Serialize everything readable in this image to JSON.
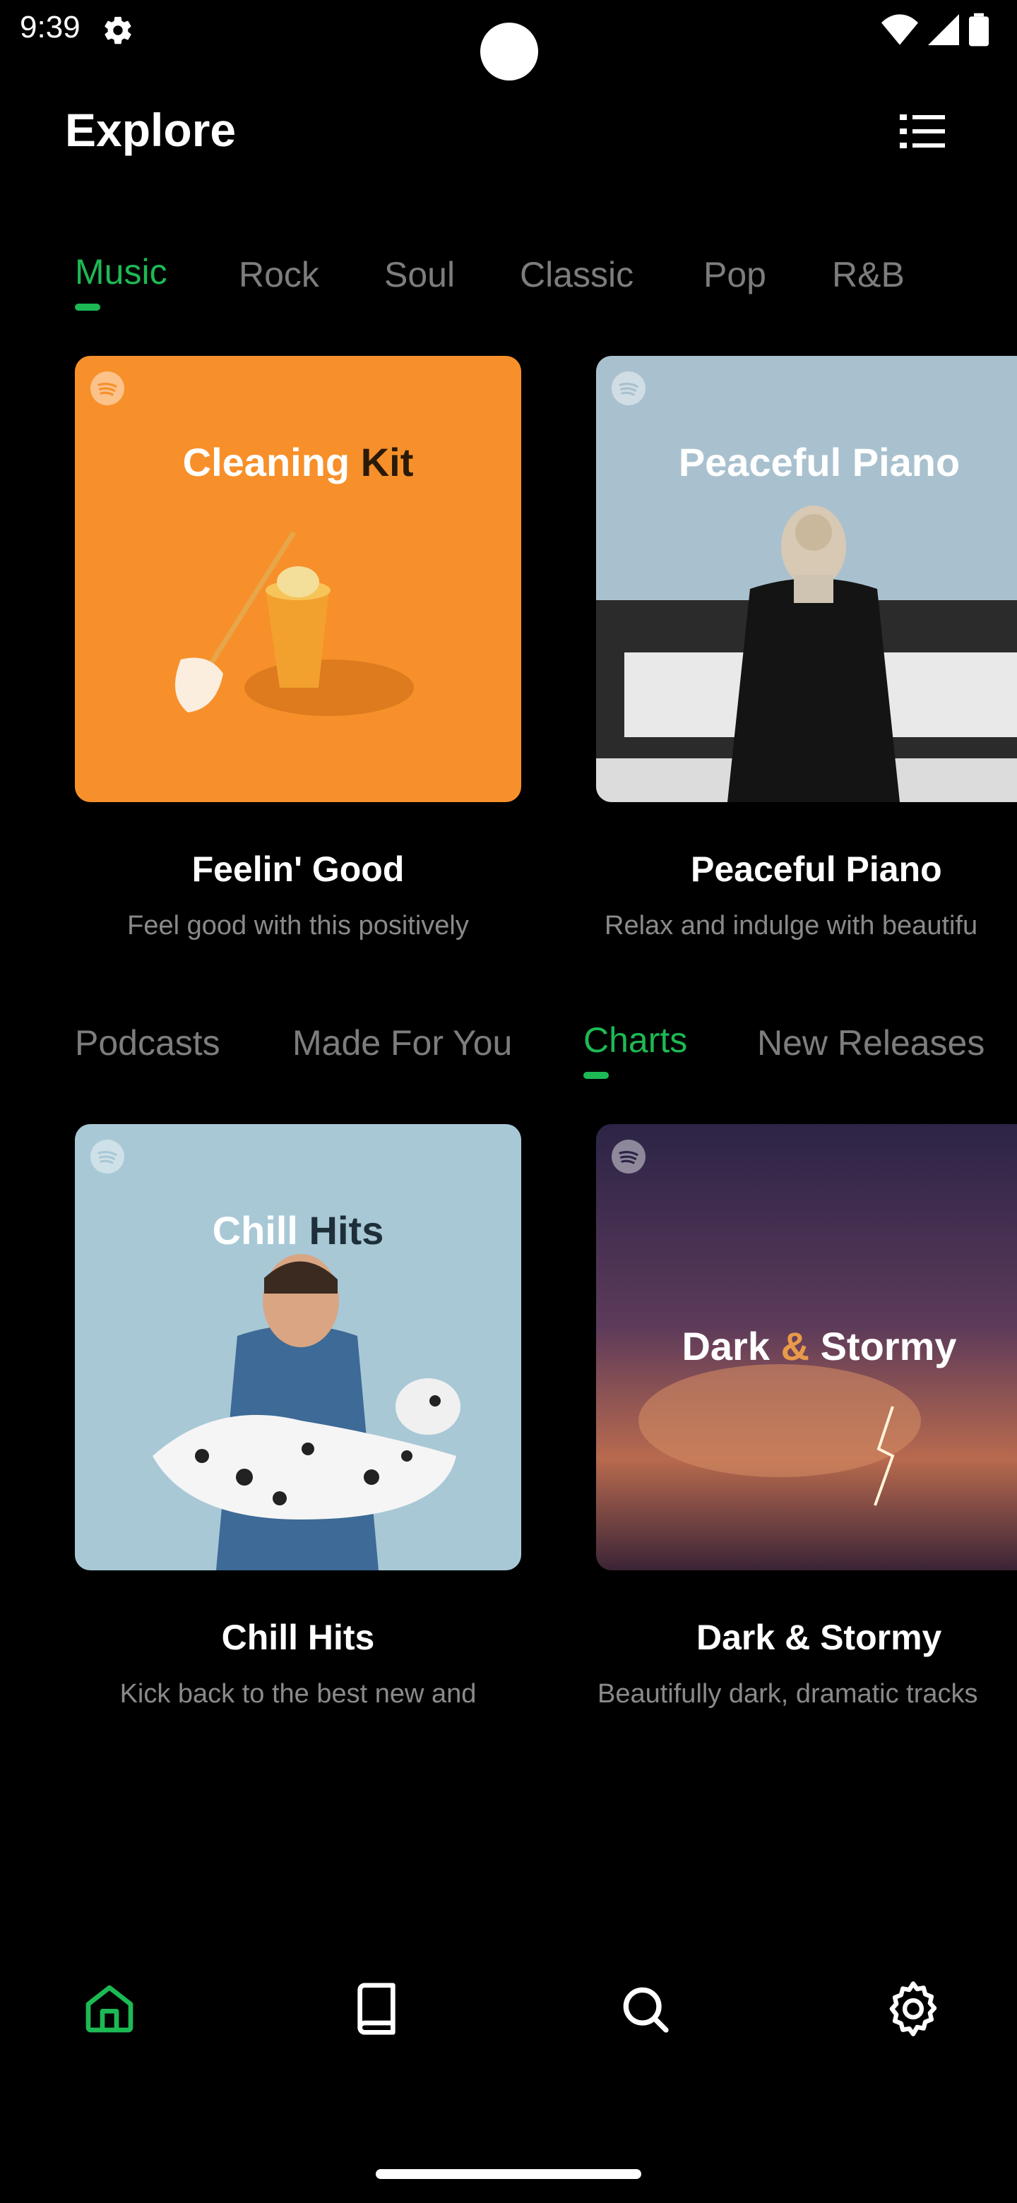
{
  "status_bar": {
    "time": "9:39",
    "icons": [
      "gear-icon",
      "wifi-icon",
      "signal-icon",
      "battery-icon"
    ]
  },
  "header": {
    "title": "Explore",
    "menu_icon": "list-menu-icon"
  },
  "genre_tabs": [
    {
      "label": "Music",
      "active": true
    },
    {
      "label": "Rock",
      "active": false
    },
    {
      "label": "Soul",
      "active": false
    },
    {
      "label": "Classic",
      "active": false
    },
    {
      "label": "Pop",
      "active": false
    },
    {
      "label": "R&B",
      "active": false
    }
  ],
  "genre_cards": [
    {
      "art_text_a": "Cleaning",
      "art_text_b": "Kit",
      "title": "Feelin' Good",
      "subtitle": "Feel good with this positively"
    },
    {
      "art_text_a": "Peaceful Piano",
      "art_text_b": "",
      "title": "Peaceful Piano",
      "subtitle": "Relax and indulge with beautifu"
    }
  ],
  "category_tabs": [
    {
      "label": "Podcasts",
      "active": false
    },
    {
      "label": "Made For You",
      "active": false
    },
    {
      "label": "Charts",
      "active": true
    },
    {
      "label": "New Releases",
      "active": false
    }
  ],
  "category_cards": [
    {
      "art_text_a": "Chill",
      "art_text_b": "Hits",
      "title": "Chill Hits",
      "subtitle": "Kick back to the best new and"
    },
    {
      "art_text_a": "Dark",
      "art_text_amp": "&",
      "art_text_b": "Stormy",
      "title": "Dark & Stormy",
      "subtitle": "Beautifully dark, dramatic tracks"
    }
  ],
  "bottom_nav": [
    {
      "icon": "home-icon",
      "active": true
    },
    {
      "icon": "book-icon",
      "active": false
    },
    {
      "icon": "search-icon",
      "active": false
    },
    {
      "icon": "settings-icon",
      "active": false
    }
  ],
  "colors": {
    "accent": "#1db954",
    "background": "#000000",
    "inactive_tab": "#7d7d7d",
    "subtitle": "#8a8a8a"
  }
}
